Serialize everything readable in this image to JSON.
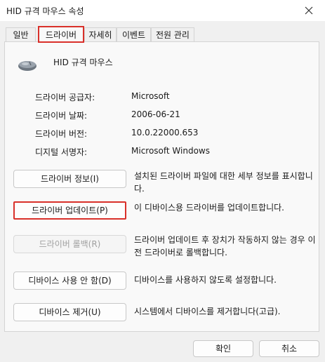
{
  "window": {
    "title": "HID 규격 마우스 속성"
  },
  "tabs": [
    {
      "label": "일반"
    },
    {
      "label": "드라이버"
    },
    {
      "label": "자세히"
    },
    {
      "label": "이벤트"
    },
    {
      "label": "전원 관리"
    }
  ],
  "device": {
    "name": "HID 규격 마우스",
    "icon": "mouse-icon"
  },
  "info": [
    {
      "label": "드라이버 공급자:",
      "value": "Microsoft"
    },
    {
      "label": "드라이버 날짜:",
      "value": "2006-06-21"
    },
    {
      "label": "드라이버 버전:",
      "value": "10.0.22000.653"
    },
    {
      "label": "디지털 서명자:",
      "value": "Microsoft Windows"
    }
  ],
  "actions": [
    {
      "button": "드라이버 정보(I)",
      "description": "설치된 드라이버 파일에 대한 세부 정보를 표시합니다."
    },
    {
      "button": "드라이버 업데이트(P)",
      "description": "이 디바이스용 드라이버를 업데이트합니다."
    },
    {
      "button": "드라이버 롤백(R)",
      "description": "드라이버 업데이트 후 장치가 작동하지 않는 경우 이전 드라이버로 롤백합니다."
    },
    {
      "button": "디바이스 사용 안 함(D)",
      "description": "디바이스를 사용하지 않도록 설정합니다."
    },
    {
      "button": "디바이스 제거(U)",
      "description": "시스템에서 디바이스를 제거합니다(고급)."
    }
  ],
  "footer": {
    "ok_label": "확인",
    "cancel_label": "취소"
  },
  "colors": {
    "highlight": "#d9302a",
    "background": "#f0f0f0",
    "panel": "#f9f9f9"
  }
}
